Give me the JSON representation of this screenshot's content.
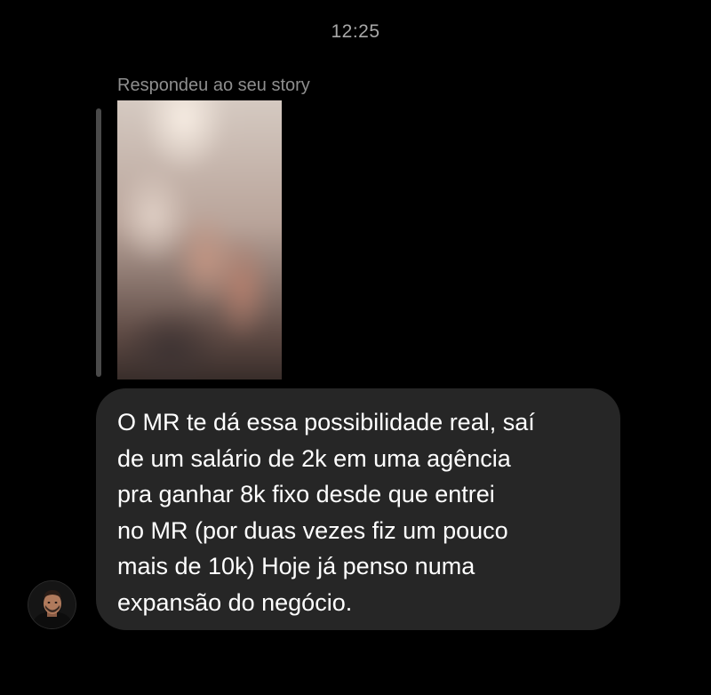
{
  "chat": {
    "time": "12:25",
    "reply_label": "Respondeu ao seu story",
    "story_thumbnail": "blurred-story-preview",
    "message": {
      "text": "O MR te dá essa possibilidade real, saí\nde um salário de 2k em uma agência\npra ganhar 8k fixo desde que entrei\nno MR (por duas vezes fiz um pouco\nmais de 10k) Hoje já penso numa\nexpansão do negócio."
    },
    "sender": {
      "avatar_icon": "person-avatar-icon"
    }
  },
  "colors": {
    "background": "#000000",
    "bubble": "#262626",
    "meta_text": "#a8a8a8",
    "reply_bar": "#4a4a4a"
  }
}
